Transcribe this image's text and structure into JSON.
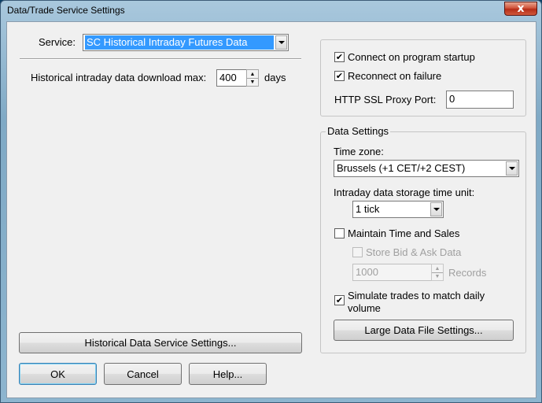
{
  "window": {
    "title": "Data/Trade Service Settings",
    "close_symbol": "x"
  },
  "service": {
    "label": "Service:",
    "selected": "SC Historical Intraday Futures Data"
  },
  "download": {
    "label": "Historical intraday data download max:",
    "value": "400",
    "unit": "days"
  },
  "connection": {
    "connect_on_startup": {
      "label": "Connect on program startup",
      "checked": true
    },
    "reconnect_on_failure": {
      "label": "Reconnect on failure",
      "checked": true
    },
    "proxy_port": {
      "label": "HTTP SSL Proxy Port:",
      "value": "0"
    }
  },
  "data_settings": {
    "caption": "Data Settings",
    "time_zone": {
      "label": "Time zone:",
      "selected": "Brussels (+1 CET/+2 CEST)"
    },
    "storage_unit": {
      "label": "Intraday data storage time unit:",
      "selected": "1 tick"
    },
    "maintain_time_sales": {
      "label": "Maintain Time and Sales",
      "checked": false
    },
    "store_bid_ask": {
      "label": "Store Bid & Ask Data",
      "checked": false,
      "enabled": false
    },
    "records": {
      "value": "1000",
      "label": "Records",
      "enabled": false
    },
    "simulate_trades": {
      "label_line1": "Simulate trades to match daily",
      "label_line2": "volume",
      "checked": true
    },
    "large_file_button": "Large Data File Settings..."
  },
  "buttons": {
    "historical_settings": "Historical Data Service Settings...",
    "ok": "OK",
    "cancel": "Cancel",
    "help": "Help..."
  },
  "glyphs": {
    "check": "✔",
    "spin_up": "▲",
    "spin_down": "▼"
  }
}
